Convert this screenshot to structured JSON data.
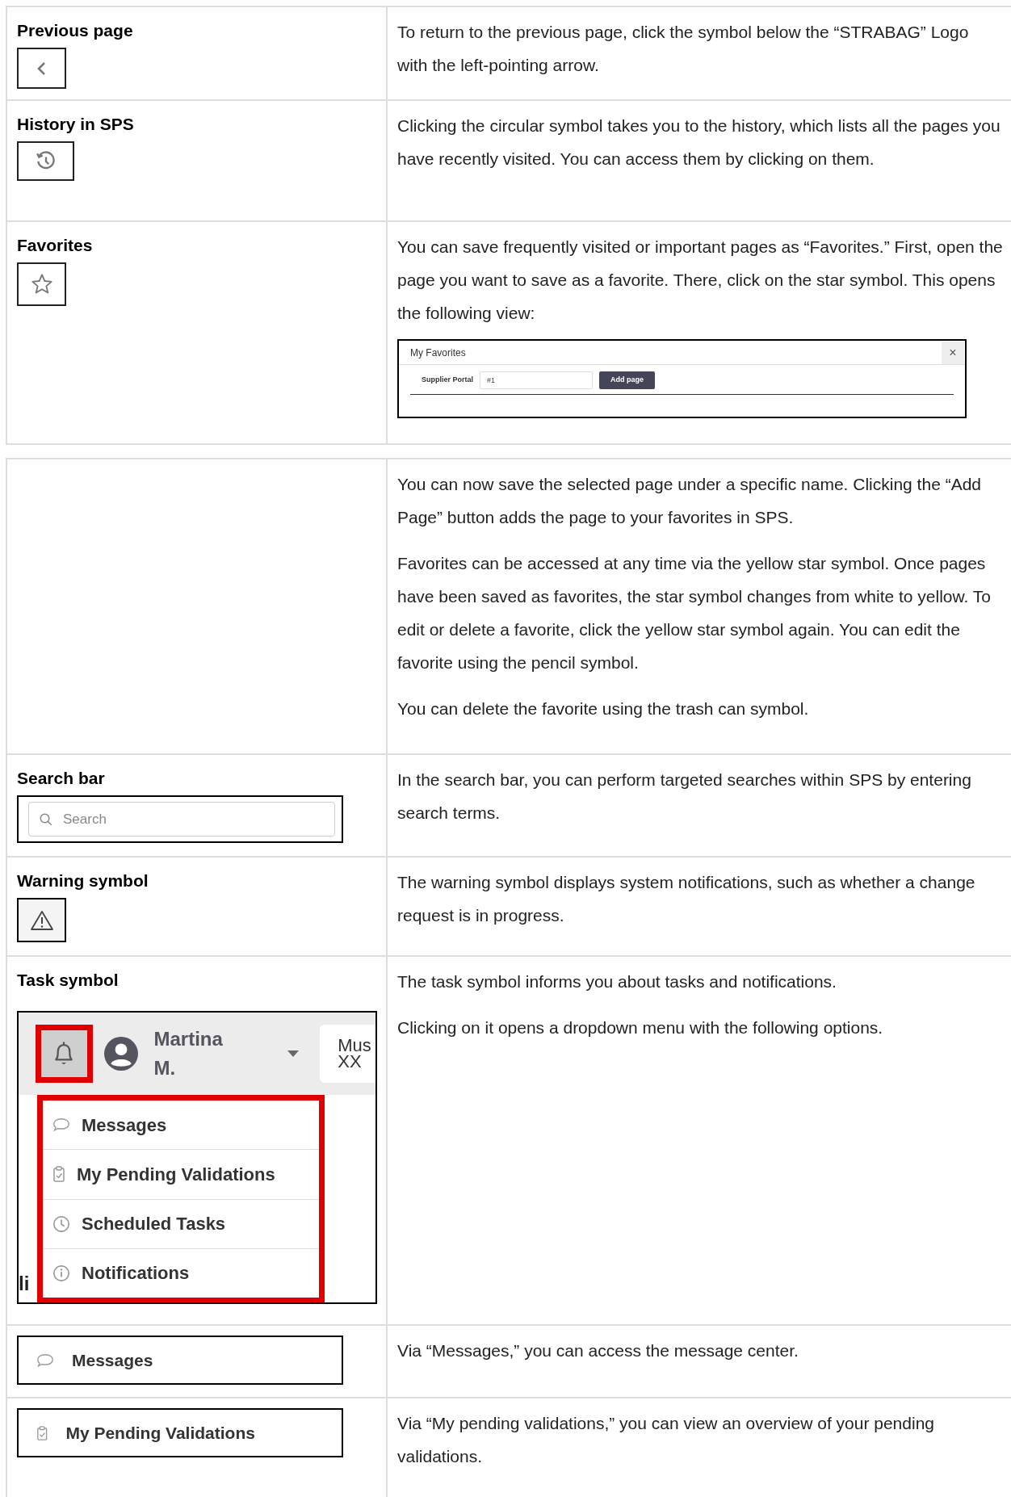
{
  "table_1": {
    "rows": [
      {
        "title": "Previous page",
        "paragraphs": [
          "To return to the previous page, click the symbol below the “STRABAG” Logo with the left-pointing arrow."
        ]
      },
      {
        "title": "History in SPS",
        "paragraphs": [
          "Clicking the circular symbol takes you to the history, which lists all the pages you have recently visited. You can access them by clicking on them."
        ]
      },
      {
        "title": "Favorites",
        "paragraphs": [
          "You can save frequently visited or important pages as “Favorites.” First, open the page you want to save as a favorite.  There, click on the star symbol. This opens the following view:"
        ],
        "dialog": {
          "title": "My Favorites",
          "close": "×",
          "label": "Supplier Portal",
          "value": "#1",
          "button": "Add page"
        }
      }
    ]
  },
  "table_2": {
    "rows": [
      {
        "kind": "empty",
        "paragraphs": [
          "You can now save the selected page under a specific name. Clicking the “Add Page” button adds the page to your favorites in SPS.",
          "Favorites can be accessed at any time via the yellow star symbol. Once pages have been saved as favorites, the star symbol changes from white to yellow. To edit or delete a favorite, click the yellow star symbol again. You can edit the favorite using the pencil symbol.",
          "You can delete the favorite using the trash can symbol."
        ]
      },
      {
        "kind": "search",
        "title": "Search bar",
        "placeholder": "Search",
        "paragraphs": [
          "In the search bar, you can perform targeted searches within SPS by entering search terms."
        ]
      },
      {
        "kind": "icon",
        "title": "Warning symbol",
        "paragraphs": [
          "The warning symbol displays system notifications, such as whether a change request is in progress."
        ]
      },
      {
        "kind": "menu",
        "title": "Task symbol",
        "user": "Martina M.",
        "box_lines": [
          "Mus",
          "XX"
        ],
        "edge_text": "li",
        "menu": [
          "Messages",
          "My Pending Validations",
          "Scheduled Tasks",
          "Notifications"
        ],
        "paragraphs": [
          "The task symbol informs you about tasks and notifications.",
          "Clicking on it opens a dropdown menu with the following options."
        ]
      },
      {
        "kind": "menu_item",
        "item": "Messages",
        "paragraphs": [
          "Via “Messages,” you can access the message center."
        ]
      },
      {
        "kind": "menu_item",
        "item": "My Pending Validations",
        "paragraphs": [
          "Via “My pending validations,” you can view an overview of your pending validations."
        ]
      }
    ]
  }
}
